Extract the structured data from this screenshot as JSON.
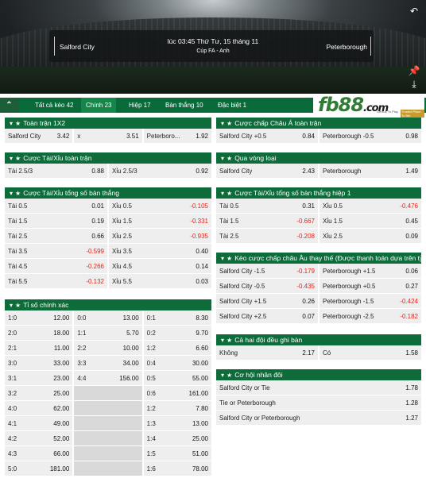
{
  "match": {
    "home": "Salford City",
    "away": "Peterborough",
    "time": "lúc 03:45 Thứ Tư, 15 tháng 11",
    "league": "Cúp FA - Anh"
  },
  "tabs": [
    {
      "label": "Tất cả kèo 42"
    },
    {
      "label": "Chính 23"
    },
    {
      "label": "Hiệp 17"
    },
    {
      "label": "Bàn thắng 10"
    },
    {
      "label": "Đặc biệt 1"
    }
  ],
  "logo": {
    "text_fb": "fb",
    "text_88": "88",
    "text_com": ".com",
    "tag1": "Genius To Play",
    "tag2": "Trusted Place To Bet"
  },
  "panels": {
    "p1x2": {
      "title": "Toàn trận 1X2",
      "rows": [
        [
          [
            "Salford City",
            "3.42"
          ],
          [
            "x",
            "3.51"
          ],
          [
            "Peterboro...",
            "1.92"
          ]
        ]
      ]
    },
    "pou": {
      "title": "Cược Tài/Xỉu toàn trận",
      "rows": [
        [
          [
            "Tài 2.5/3",
            "0.88"
          ],
          [
            "Xỉu 2.5/3",
            "0.92"
          ]
        ]
      ]
    },
    "pou_goals": {
      "title": "Cược Tài/Xỉu tổng số bàn thắng",
      "rows": [
        [
          [
            "Tài 0.5",
            "0.01"
          ],
          [
            "Xỉu 0.5",
            "-0.105"
          ]
        ],
        [
          [
            "Tài 1.5",
            "0.19"
          ],
          [
            "Xỉu 1.5",
            "-0.331"
          ]
        ],
        [
          [
            "Tài 2.5",
            "0.66"
          ],
          [
            "Xỉu 2.5",
            "-0.935"
          ]
        ],
        [
          [
            "Tài 3.5",
            "-0.599"
          ],
          [
            "Xỉu 3.5",
            "0.40"
          ]
        ],
        [
          [
            "Tài 4.5",
            "-0.266"
          ],
          [
            "Xỉu 4.5",
            "0.14"
          ]
        ],
        [
          [
            "Tài 5.5",
            "-0.132"
          ],
          [
            "Xỉu 5.5",
            "0.03"
          ]
        ]
      ]
    },
    "pcs": {
      "title": "Tỉ số chính xác",
      "rows": [
        [
          [
            "1:0",
            "12.00"
          ],
          [
            "0:0",
            "13.00"
          ],
          [
            "0:1",
            "8.30"
          ]
        ],
        [
          [
            "2:0",
            "18.00"
          ],
          [
            "1:1",
            "5.70"
          ],
          [
            "0:2",
            "9.70"
          ]
        ],
        [
          [
            "2:1",
            "11.00"
          ],
          [
            "2:2",
            "10.00"
          ],
          [
            "1:2",
            "6.60"
          ]
        ],
        [
          [
            "3:0",
            "33.00"
          ],
          [
            "3:3",
            "34.00"
          ],
          [
            "0:4",
            "30.00"
          ]
        ],
        [
          [
            "3:1",
            "23.00"
          ],
          [
            "4:4",
            "156.00"
          ],
          [
            "0:5",
            "55.00"
          ]
        ],
        [
          [
            "3:2",
            "25.00"
          ],
          [
            "",
            ""
          ],
          [
            "0:6",
            "161.00"
          ]
        ],
        [
          [
            "4:0",
            "62.00"
          ],
          [
            "",
            ""
          ],
          [
            "1:2",
            "7.80"
          ]
        ],
        [
          [
            "4:1",
            "49.00"
          ],
          [
            "",
            ""
          ],
          [
            "1:3",
            "13.00"
          ]
        ],
        [
          [
            "4:2",
            "52.00"
          ],
          [
            "",
            ""
          ],
          [
            "1:4",
            "25.00"
          ]
        ],
        [
          [
            "4:3",
            "66.00"
          ],
          [
            "",
            ""
          ],
          [
            "1:5",
            "51.00"
          ]
        ],
        [
          [
            "5:0",
            "181.00"
          ],
          [
            "",
            ""
          ],
          [
            "1:6",
            "78.00"
          ]
        ]
      ]
    },
    "pah": {
      "title": "Cược chấp Châu Á toàn trận",
      "rows": [
        [
          [
            "Salford City +0.5",
            "0.84"
          ],
          [
            "Peterborough -0.5",
            "0.98"
          ]
        ]
      ]
    },
    "pqual": {
      "title": "Qua vòng loại",
      "rows": [
        [
          [
            "Salford City",
            "2.43"
          ],
          [
            "Peterborough",
            "1.49"
          ]
        ]
      ]
    },
    "pou_h1": {
      "title": "Cược Tài/Xỉu tổng số bàn thắng hiệp 1",
      "rows": [
        [
          [
            "Tài 0.5",
            "0.31"
          ],
          [
            "Xỉu 0.5",
            "-0.476"
          ]
        ],
        [
          [
            "Tài 1.5",
            "-0.667"
          ],
          [
            "Xỉu 1.5",
            "0.45"
          ]
        ],
        [
          [
            "Tài 2.5",
            "-0.208"
          ],
          [
            "Xỉu 2.5",
            "0.09"
          ]
        ]
      ]
    },
    "peh": {
      "title": "Kèo cược chấp châu Âu thay thế (Được thanh toán dựa trên tỷ...",
      "rows": [
        [
          [
            "Salford City -1.5",
            "-0.179"
          ],
          [
            "Peterborough +1.5",
            "0.06"
          ]
        ],
        [
          [
            "Salford City -0.5",
            "-0.435"
          ],
          [
            "Peterborough +0.5",
            "0.27"
          ]
        ],
        [
          [
            "Salford City +1.5",
            "0.26"
          ],
          [
            "Peterborough -1.5",
            "-0.424"
          ]
        ],
        [
          [
            "Salford City +2.5",
            "0.07"
          ],
          [
            "Peterborough -2.5",
            "-0.182"
          ]
        ]
      ]
    },
    "pbts": {
      "title": "Cả hai đội đều ghi bàn",
      "rows": [
        [
          [
            "Không",
            "2.17"
          ],
          [
            "Có",
            "1.58"
          ]
        ]
      ]
    },
    "pdc": {
      "title": "Cơ hội nhân đôi",
      "rows": [
        [
          [
            "Salford City or Tie",
            "1.78"
          ]
        ],
        [
          [
            "Tie or Peterborough",
            "1.28"
          ]
        ],
        [
          [
            "Salford City or Peterborough",
            "1.27"
          ]
        ]
      ]
    }
  }
}
